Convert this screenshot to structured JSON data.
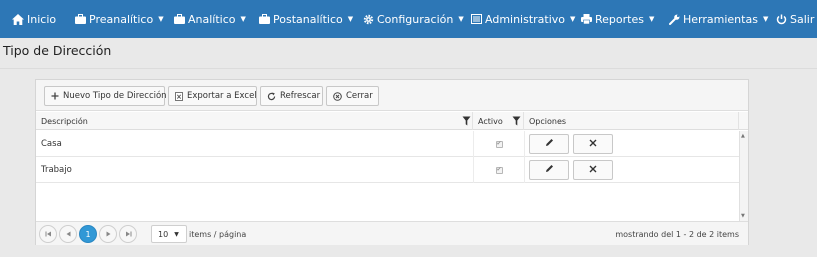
{
  "navbar": {
    "items": [
      {
        "label": "Inicio",
        "icon": "home-icon",
        "dropdown": false
      },
      {
        "label": "Preanalítico",
        "icon": "briefcase-icon",
        "dropdown": true
      },
      {
        "label": "Analítico",
        "icon": "briefcase-icon",
        "dropdown": true
      },
      {
        "label": "Postanalítico",
        "icon": "briefcase-icon",
        "dropdown": true
      },
      {
        "label": "Configuración",
        "icon": "gear-icon",
        "dropdown": true
      },
      {
        "label": "Administrativo",
        "icon": "list-icon",
        "dropdown": true
      },
      {
        "label": "Reportes",
        "icon": "printer-icon",
        "dropdown": true
      },
      {
        "label": "Herramientas",
        "icon": "wrench-icon",
        "dropdown": true
      },
      {
        "label": "Salir",
        "icon": "power-icon",
        "dropdown": false
      }
    ],
    "color": "#2d77b6"
  },
  "page": {
    "title": "Tipo de Dirección"
  },
  "toolbar": {
    "new_label": "Nuevo Tipo de Dirección",
    "export_label": "Exportar a Excel",
    "refresh_label": "Refrescar",
    "close_label": "Cerrar"
  },
  "grid": {
    "columns": [
      "Descripción",
      "Activo",
      "Opciones"
    ],
    "rows": [
      {
        "descripcion": "Casa",
        "activo": true
      },
      {
        "descripcion": "Trabajo",
        "activo": true
      }
    ]
  },
  "pager": {
    "current_page": "1",
    "page_size": "10",
    "items_per_page_label": "items / página",
    "summary": "mostrando del 1 - 2 de 2 items"
  },
  "colors": {
    "accent": "#3198d6",
    "nav": "#2d77b6"
  }
}
